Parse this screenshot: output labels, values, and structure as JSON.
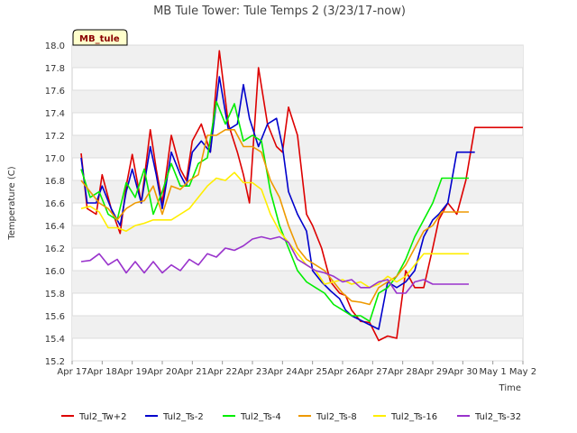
{
  "chart_data": {
    "type": "line",
    "title": "MB Tule Tower: Tule Temps 2 (3/23/17-now)",
    "xlabel": "Time",
    "ylabel": "Temperature (C)",
    "badge": "MB_tule",
    "ylim": [
      15.2,
      18.0
    ],
    "y_ticks": [
      "15.2",
      "15.4",
      "15.6",
      "15.8",
      "16.0",
      "16.2",
      "16.4",
      "16.6",
      "16.8",
      "17.0",
      "17.2",
      "17.4",
      "17.6",
      "17.8",
      "18.0"
    ],
    "x_ticks": [
      "Apr 17",
      "Apr 18",
      "Apr 19",
      "Apr 20",
      "Apr 21",
      "Apr 22",
      "Apr 23",
      "Apr 24",
      "Apr 25",
      "Apr 26",
      "Apr 27",
      "Apr 28",
      "Apr 29",
      "Apr 30",
      "May 1",
      "May 2"
    ],
    "xlim": [
      0,
      15
    ],
    "x_unit": "days since Apr 17",
    "grid": true,
    "legend_position": "bottom",
    "series": [
      {
        "name": "Tul2_Tw+2",
        "color": "#dd0000",
        "x": [
          0.3,
          0.5,
          0.8,
          1.0,
          1.3,
          1.6,
          1.8,
          2.0,
          2.3,
          2.6,
          2.8,
          3.0,
          3.3,
          3.6,
          3.8,
          4.0,
          4.3,
          4.6,
          4.9,
          5.2,
          5.5,
          5.7,
          5.9,
          6.2,
          6.5,
          6.8,
          7.0,
          7.2,
          7.5,
          7.8,
          8.0,
          8.3,
          8.6,
          8.9,
          9.1,
          9.3,
          9.6,
          9.9,
          10.2,
          10.5,
          10.8,
          11.1,
          11.4,
          11.7,
          12.0,
          12.2,
          12.5,
          12.8,
          13.1,
          13.4,
          13.7,
          14.0,
          14.3,
          14.6,
          14.8,
          15.0
        ],
        "y": [
          17.04,
          16.55,
          16.5,
          16.85,
          16.55,
          16.33,
          16.75,
          17.03,
          16.6,
          17.25,
          16.9,
          16.6,
          17.2,
          16.9,
          16.8,
          17.15,
          17.3,
          17.05,
          17.95,
          17.3,
          17.05,
          16.85,
          16.6,
          17.8,
          17.3,
          17.1,
          17.05,
          17.45,
          17.2,
          16.5,
          16.4,
          16.2,
          15.9,
          15.8,
          15.78,
          15.65,
          15.55,
          15.54,
          15.38,
          15.42,
          15.4,
          16.0,
          15.85,
          15.85,
          16.2,
          16.45,
          16.6,
          16.5,
          16.8,
          17.27,
          17.27,
          17.27,
          17.27,
          17.27,
          17.27,
          17.27
        ]
      },
      {
        "name": "Tul2_Ts-2",
        "color": "#0000cc",
        "x": [
          0.3,
          0.5,
          0.8,
          1.0,
          1.3,
          1.6,
          1.8,
          2.0,
          2.3,
          2.6,
          2.8,
          3.0,
          3.3,
          3.6,
          3.8,
          4.0,
          4.3,
          4.6,
          4.9,
          5.2,
          5.5,
          5.7,
          5.9,
          6.2,
          6.5,
          6.8,
          7.0,
          7.2,
          7.5,
          7.8,
          8.0,
          8.3,
          8.6,
          8.9,
          9.1,
          9.3,
          9.6,
          9.9,
          10.2,
          10.5,
          10.8,
          11.1,
          11.4,
          11.7,
          12.0,
          12.2,
          12.5,
          12.8,
          13.1,
          13.4
        ],
        "y": [
          17.0,
          16.6,
          16.6,
          16.75,
          16.55,
          16.4,
          16.7,
          16.9,
          16.6,
          17.1,
          16.85,
          16.55,
          17.05,
          16.85,
          16.75,
          17.05,
          17.15,
          17.05,
          17.72,
          17.25,
          17.3,
          17.65,
          17.35,
          17.1,
          17.3,
          17.35,
          17.1,
          16.7,
          16.5,
          16.35,
          16.0,
          15.9,
          15.82,
          15.75,
          15.65,
          15.6,
          15.56,
          15.52,
          15.48,
          15.9,
          15.85,
          15.9,
          16.0,
          16.3,
          16.45,
          16.5,
          16.6,
          17.05,
          17.05,
          17.05
        ]
      },
      {
        "name": "Tul2_Ts-4",
        "color": "#00ee00",
        "x": [
          0.3,
          0.6,
          0.9,
          1.2,
          1.5,
          1.8,
          2.1,
          2.4,
          2.7,
          3.0,
          3.3,
          3.6,
          3.9,
          4.2,
          4.5,
          4.8,
          5.1,
          5.4,
          5.7,
          6.0,
          6.3,
          6.6,
          6.9,
          7.2,
          7.5,
          7.8,
          8.1,
          8.4,
          8.7,
          9.0,
          9.3,
          9.6,
          9.9,
          10.2,
          10.5,
          10.8,
          11.1,
          11.4,
          11.7,
          12.0,
          12.3,
          12.6,
          12.9,
          13.2
        ],
        "y": [
          16.9,
          16.65,
          16.7,
          16.5,
          16.45,
          16.78,
          16.65,
          16.9,
          16.5,
          16.7,
          16.95,
          16.75,
          16.75,
          16.95,
          17.0,
          17.5,
          17.3,
          17.48,
          17.15,
          17.2,
          17.15,
          16.7,
          16.4,
          16.2,
          16.0,
          15.9,
          15.85,
          15.8,
          15.7,
          15.65,
          15.6,
          15.6,
          15.55,
          15.8,
          15.85,
          15.95,
          16.1,
          16.3,
          16.45,
          16.6,
          16.82,
          16.82,
          16.82,
          16.82
        ]
      },
      {
        "name": "Tul2_Ts-8",
        "color": "#ee9900",
        "x": [
          0.3,
          0.6,
          0.9,
          1.2,
          1.5,
          1.8,
          2.1,
          2.4,
          2.7,
          3.0,
          3.3,
          3.6,
          3.9,
          4.2,
          4.5,
          4.8,
          5.1,
          5.4,
          5.7,
          6.0,
          6.3,
          6.6,
          6.9,
          7.2,
          7.5,
          7.8,
          8.1,
          8.4,
          8.7,
          9.0,
          9.3,
          9.6,
          9.9,
          10.2,
          10.5,
          10.8,
          11.1,
          11.4,
          11.7,
          12.0,
          12.3,
          12.6,
          12.9,
          13.2
        ],
        "y": [
          16.8,
          16.7,
          16.6,
          16.55,
          16.45,
          16.55,
          16.6,
          16.62,
          16.75,
          16.5,
          16.75,
          16.72,
          16.8,
          16.85,
          17.2,
          17.2,
          17.25,
          17.25,
          17.1,
          17.1,
          17.05,
          16.8,
          16.65,
          16.4,
          16.2,
          16.1,
          16.05,
          16.0,
          15.9,
          15.8,
          15.73,
          15.72,
          15.7,
          15.85,
          15.9,
          15.95,
          16.05,
          16.2,
          16.35,
          16.4,
          16.52,
          16.52,
          16.52,
          16.52
        ]
      },
      {
        "name": "Tul2_Ts-16",
        "color": "#ffee00",
        "x": [
          0.3,
          0.6,
          0.9,
          1.2,
          1.5,
          1.8,
          2.1,
          2.4,
          2.7,
          3.0,
          3.3,
          3.6,
          3.9,
          4.2,
          4.5,
          4.8,
          5.1,
          5.4,
          5.7,
          6.0,
          6.3,
          6.6,
          6.9,
          7.2,
          7.5,
          7.8,
          8.1,
          8.4,
          8.7,
          9.0,
          9.3,
          9.6,
          9.9,
          10.2,
          10.5,
          10.8,
          11.1,
          11.4,
          11.7,
          12.0,
          12.3,
          12.6,
          12.9,
          13.2
        ],
        "y": [
          16.55,
          16.57,
          16.52,
          16.38,
          16.38,
          16.35,
          16.4,
          16.42,
          16.45,
          16.45,
          16.45,
          16.5,
          16.55,
          16.65,
          16.75,
          16.82,
          16.8,
          16.87,
          16.78,
          16.78,
          16.72,
          16.5,
          16.35,
          16.25,
          16.15,
          16.05,
          16.0,
          15.88,
          15.9,
          15.92,
          15.88,
          15.9,
          15.85,
          15.88,
          15.95,
          15.9,
          15.95,
          16.05,
          16.15,
          16.15,
          16.15,
          16.15,
          16.15,
          16.15
        ]
      },
      {
        "name": "Tul2_Ts-32",
        "color": "#9933cc",
        "x": [
          0.3,
          0.6,
          0.9,
          1.2,
          1.5,
          1.8,
          2.1,
          2.4,
          2.7,
          3.0,
          3.3,
          3.6,
          3.9,
          4.2,
          4.5,
          4.8,
          5.1,
          5.4,
          5.7,
          6.0,
          6.3,
          6.6,
          6.9,
          7.2,
          7.5,
          7.8,
          8.1,
          8.4,
          8.7,
          9.0,
          9.3,
          9.6,
          9.9,
          10.2,
          10.5,
          10.8,
          11.1,
          11.4,
          11.7,
          12.0,
          12.3,
          12.6,
          12.9,
          13.2
        ],
        "y": [
          16.08,
          16.09,
          16.15,
          16.05,
          16.1,
          15.98,
          16.08,
          15.98,
          16.08,
          15.98,
          16.05,
          16.0,
          16.1,
          16.05,
          16.15,
          16.12,
          16.2,
          16.18,
          16.22,
          16.28,
          16.3,
          16.28,
          16.3,
          16.25,
          16.1,
          16.05,
          16.0,
          15.98,
          15.95,
          15.9,
          15.92,
          15.85,
          15.85,
          15.9,
          15.92,
          15.8,
          15.8,
          15.9,
          15.92,
          15.88,
          15.88,
          15.88,
          15.88,
          15.88
        ]
      }
    ]
  }
}
